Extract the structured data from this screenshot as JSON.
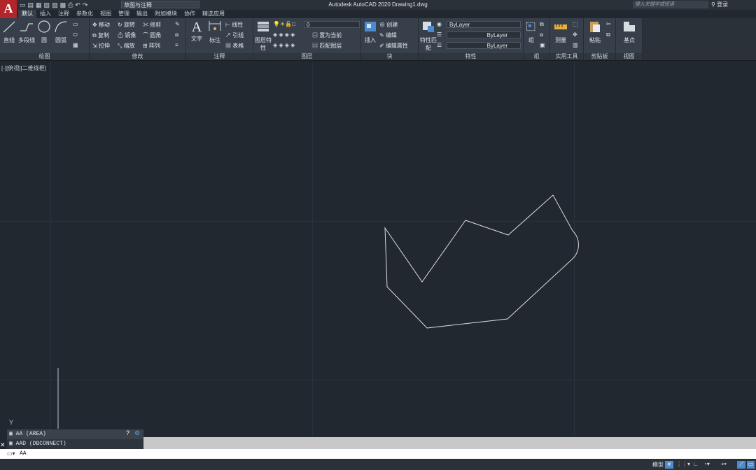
{
  "app": {
    "logo": "A",
    "title": "Autodesk AutoCAD 2020    Drawing1.dwg",
    "workspace": "草图与注释",
    "search_placeholder": "键入关键字或短语",
    "login": "登录"
  },
  "tabs": [
    "默认",
    "插入",
    "注释",
    "参数化",
    "视图",
    "管理",
    "输出",
    "附加模块",
    "协作",
    "精选应用"
  ],
  "draw": {
    "label": "绘图",
    "line": "直线",
    "polyline": "多段线",
    "circle": "圆",
    "arc": "圆弧"
  },
  "modify": {
    "label": "修改",
    "move": "移动",
    "rotate": "旋转",
    "trim": "修剪",
    "copy": "复制",
    "mirror": "镜像",
    "fillet": "圆角",
    "stretch": "拉伸",
    "scale": "缩放",
    "array": "阵列"
  },
  "annotation": {
    "label": "注释",
    "text": "文字",
    "dimension": "标注",
    "linear": "线性",
    "leader": "引线",
    "table": "表格"
  },
  "layers": {
    "label": "图层",
    "properties": "图层特性",
    "current_layer": "0",
    "make_current": "置为当前",
    "match_layer": "匹配图层"
  },
  "block": {
    "label": "块",
    "insert": "插入",
    "create": "创建",
    "edit": "编辑",
    "edit_attributes": "编辑属性"
  },
  "properties": {
    "label": "特性",
    "match": "特性匹配",
    "color": "ByLayer",
    "linetype": "ByLayer",
    "lineweight": "ByLayer"
  },
  "groups": {
    "label": "组",
    "group": "组"
  },
  "utilities": {
    "label": "实用工具",
    "measure": "测量"
  },
  "clipboard": {
    "label": "剪贴板",
    "paste": "粘贴"
  },
  "view": {
    "label": "视图",
    "base": "基点"
  },
  "viewport_label": "[-][俯视][二维线框]",
  "command_history": [
    "AA (AREA)",
    "AAD (DBCONNECT)"
  ],
  "command_input": "AA",
  "status": {
    "model": "模型"
  },
  "colors": {
    "canvas": "#212830",
    "ribbon": "#37404a",
    "accent": "#b3242b"
  }
}
